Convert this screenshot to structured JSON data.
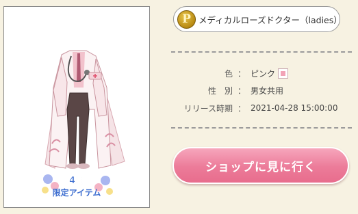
{
  "item": {
    "coin_letter": "P",
    "name": "メディカルローズドクター（ladies）",
    "image_badge": {
      "month": "4月",
      "label": "限定アイテム"
    }
  },
  "attributes": [
    {
      "label": "色",
      "value": "ピンク",
      "swatch_color": "#f2a3b6"
    },
    {
      "label": "性　別",
      "value": "男女共用"
    },
    {
      "label": "リリース時期",
      "value": "2021-04-28 15:00:00"
    }
  ],
  "separator": "：",
  "shop_button": {
    "label": "ショップに見に行く"
  },
  "colors": {
    "background": "#f7f2e2",
    "button": "#ec7b99",
    "coin": "#c89a1e"
  }
}
